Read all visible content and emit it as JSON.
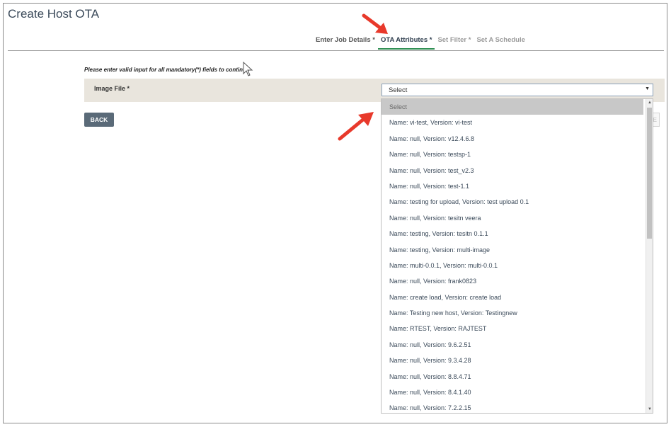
{
  "page": {
    "title": "Create Host OTA"
  },
  "steps": [
    {
      "label": "Enter Job Details *"
    },
    {
      "label": "OTA Attributes *"
    },
    {
      "label": "Set Filter *"
    },
    {
      "label": "Set A Schedule"
    }
  ],
  "form": {
    "hint": "Please enter valid input for all mandatory(*) fields to continue",
    "image_file_label": "Image File *",
    "select_value": "Select",
    "back_label": "BACK",
    "next_label_partial": "E"
  },
  "dropdown": {
    "options": [
      "Select",
      "Name: vi-test, Version: vi-test",
      "Name: null, Version: v12.4.6.8",
      "Name: null, Version: testsp-1",
      "Name: null, Version: test_v2.3",
      "Name: null, Version: test-1.1",
      "Name: testing for upload, Version: test upload 0.1",
      "Name: null, Version: tesitn veera",
      "Name: testing, Version: tesitn 0.1.1",
      "Name: testing, Version: multi-image",
      "Name: multi-0.0.1, Version: multi-0.0.1",
      "Name: null, Version: frank0823",
      "Name: create load, Version: create load",
      "Name: Testing new host, Version: Testingnew",
      "Name: RTEST, Version: RAJTEST",
      "Name: null, Version: 9.6.2.51",
      "Name: null, Version: 9.3.4.28",
      "Name: null, Version: 8.8.4.71",
      "Name: null, Version: 8.4.1.40",
      "Name: null, Version: 7.2.2.15"
    ]
  },
  "colors": {
    "accent_green": "#2f8f53",
    "arrow_red": "#e8392b",
    "button": "#5a6a78"
  }
}
